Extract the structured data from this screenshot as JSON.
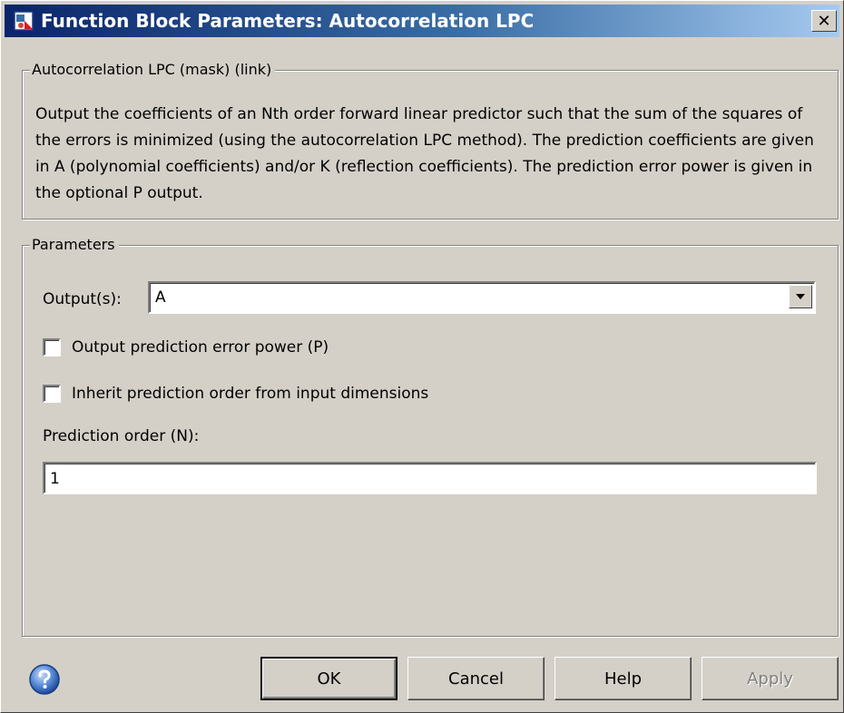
{
  "window": {
    "title": "Function Block Parameters: Autocorrelation LPC",
    "close_glyph": "✕",
    "app_icon": "simulink-block-icon"
  },
  "description_group": {
    "legend": "Autocorrelation LPC (mask) (link)",
    "text": "Output the coefficients of an Nth order forward linear predictor such that the sum of the squares of the errors is minimized (using the autocorrelation LPC method).  The prediction coefficients are given in A (polynomial coefficients) and/or K (reflection coefficients).  The prediction error power is given in the optional P output."
  },
  "parameters_group": {
    "legend": "Parameters",
    "outputs_label": "Output(s):",
    "outputs_value": "A",
    "checkbox_error_power": {
      "label": "Output prediction error power (P)",
      "checked": false
    },
    "checkbox_inherit_order": {
      "label": "Inherit prediction order from input dimensions",
      "checked": false
    },
    "prediction_order_label": "Prediction order (N):",
    "prediction_order_value": "1"
  },
  "buttons": {
    "ok": "OK",
    "cancel": "Cancel",
    "help": "Help",
    "apply": "Apply"
  },
  "colors": {
    "dialog_bg": "#d4d0c8",
    "titlebar_start": "#0a246a",
    "titlebar_end": "#a6caf0",
    "disabled_text": "#808080"
  }
}
